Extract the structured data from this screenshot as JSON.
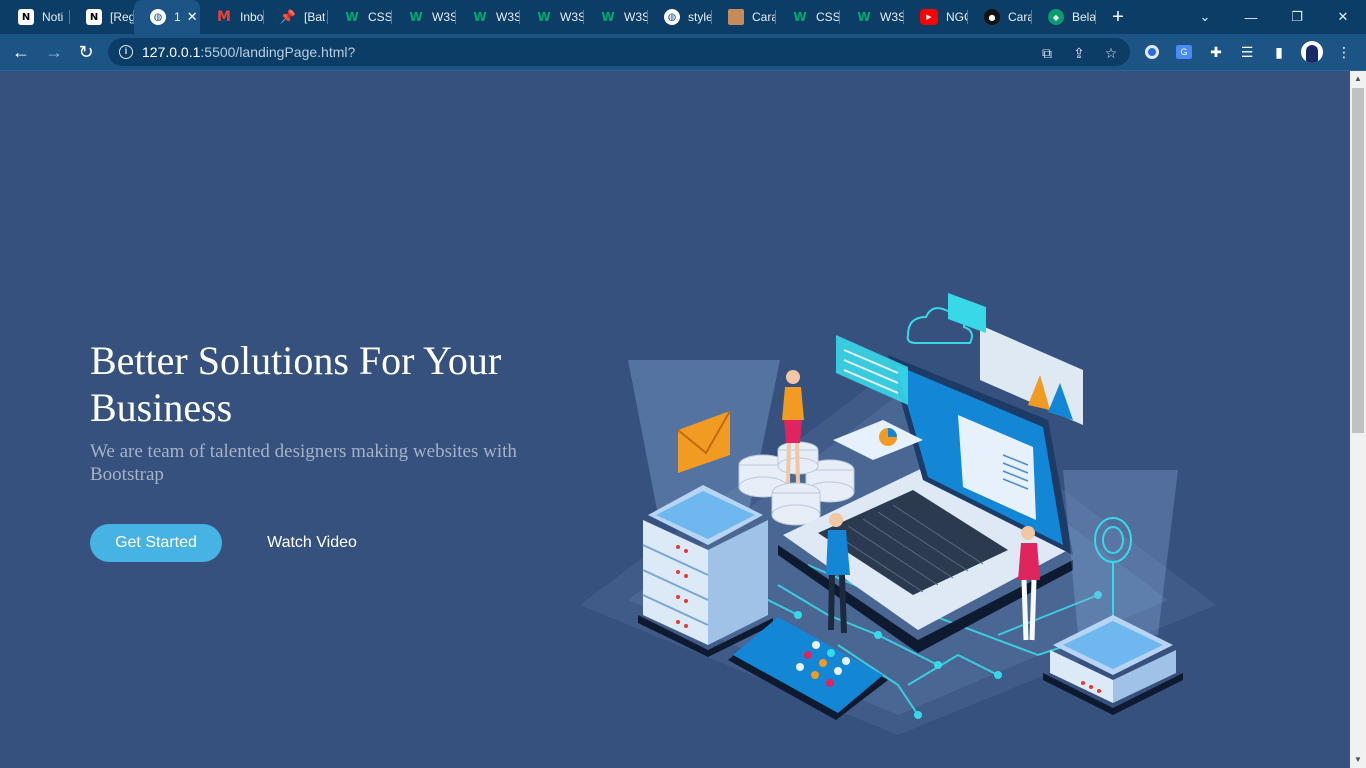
{
  "browser": {
    "tabs": [
      {
        "title": "Noti",
        "icon": "notion-icon"
      },
      {
        "title": "[Reg",
        "icon": "notion-icon"
      },
      {
        "title": "1",
        "icon": "globe-icon",
        "active": true
      },
      {
        "title": "Inbo",
        "icon": "gmail-icon"
      },
      {
        "title": "[Bat",
        "icon": "pin-icon"
      },
      {
        "title": "CSS",
        "icon": "w3schools-icon"
      },
      {
        "title": "W3S",
        "icon": "w3schools-icon"
      },
      {
        "title": "W3S",
        "icon": "w3schools-icon"
      },
      {
        "title": "W3S",
        "icon": "w3schools-icon"
      },
      {
        "title": "W3S",
        "icon": "w3schools-icon"
      },
      {
        "title": "style",
        "icon": "globe-icon"
      },
      {
        "title": "Cara",
        "icon": "avatar-icon"
      },
      {
        "title": "CSS",
        "icon": "w3schools-icon"
      },
      {
        "title": "W3S",
        "icon": "w3schools-icon"
      },
      {
        "title": "NGC",
        "icon": "youtube-icon"
      },
      {
        "title": "Cara",
        "icon": "github-icon"
      },
      {
        "title": "Bela",
        "icon": "belajar-icon"
      }
    ],
    "url_host": "127.0.0.1",
    "url_rest": ":5500/landingPage.html?"
  },
  "hero": {
    "title": "Better Solutions For Your Business",
    "subtitle": "We are team of talented designers making websites with Bootstrap",
    "cta_primary": "Get Started",
    "cta_secondary": "Watch Video"
  },
  "colors": {
    "page_bg": "#37517e",
    "accent": "#47b2e4",
    "tabstrip_bg": "#0b3d66",
    "toolbar_bg": "#1c5486"
  }
}
